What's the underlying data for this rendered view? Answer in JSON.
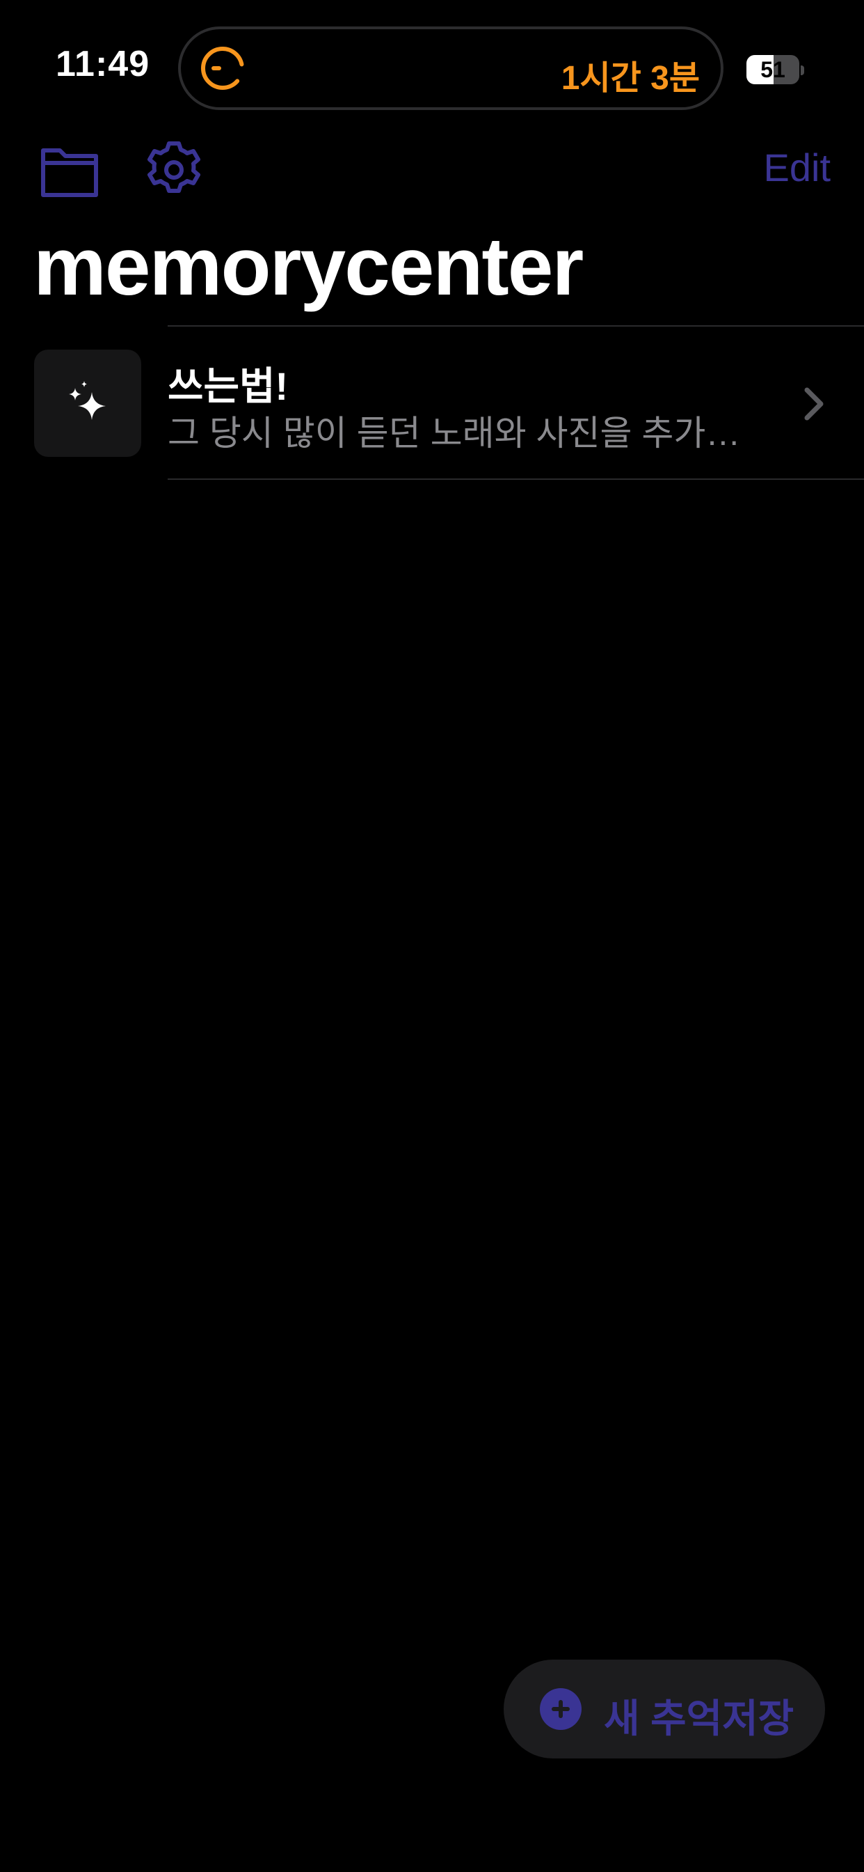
{
  "status_bar": {
    "time": "11:49",
    "timer_text": "1시간 3분",
    "timer_icon": "timer-ring-icon",
    "battery_level": "51",
    "battery_fraction": 0.51
  },
  "toolbar": {
    "folder_icon": "folder-icon",
    "settings_icon": "gear-icon",
    "edit_label": "Edit"
  },
  "page": {
    "title": "memorycenter"
  },
  "list": {
    "items": [
      {
        "icon": "sparkles-icon",
        "title": "쓰는법!",
        "subtitle": "그 당시 많이 듣던 노래와 사진을 추가해..."
      }
    ]
  },
  "fab": {
    "icon": "plus-circle-icon",
    "label": "새 추억저장"
  },
  "colors": {
    "background": "#000000",
    "accent": "#3a3494",
    "timer": "#f7951d",
    "secondary_text": "#8a8a8e",
    "thumb_background": "#161617",
    "fab_background": "#1c1c1e"
  }
}
